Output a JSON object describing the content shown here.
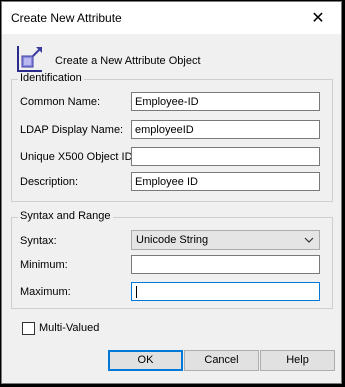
{
  "window": {
    "title": "Create New Attribute"
  },
  "header": {
    "text": "Create a New Attribute Object",
    "icon": "attribute-object-icon"
  },
  "identification": {
    "title": "Identification",
    "common_name_label": "Common Name:",
    "common_name_value": "Employee-ID",
    "ldap_label": "LDAP Display Name:",
    "ldap_value": "employeeID",
    "x500_label": "Unique X500 Object ID:",
    "x500_value": "",
    "description_label": "Description:",
    "description_value": "Employee ID"
  },
  "syntax_range": {
    "title": "Syntax and Range",
    "syntax_label": "Syntax:",
    "syntax_value": "Unicode String",
    "minimum_label": "Minimum:",
    "minimum_value": "",
    "maximum_label": "Maximum:",
    "maximum_value": ""
  },
  "multi_valued": {
    "label": "Multi-Valued",
    "checked": false
  },
  "buttons": {
    "ok": "OK",
    "cancel": "Cancel",
    "help": "Help"
  },
  "colors": {
    "accent": "#0078d7",
    "dialog_bg": "#f0f0f0"
  }
}
